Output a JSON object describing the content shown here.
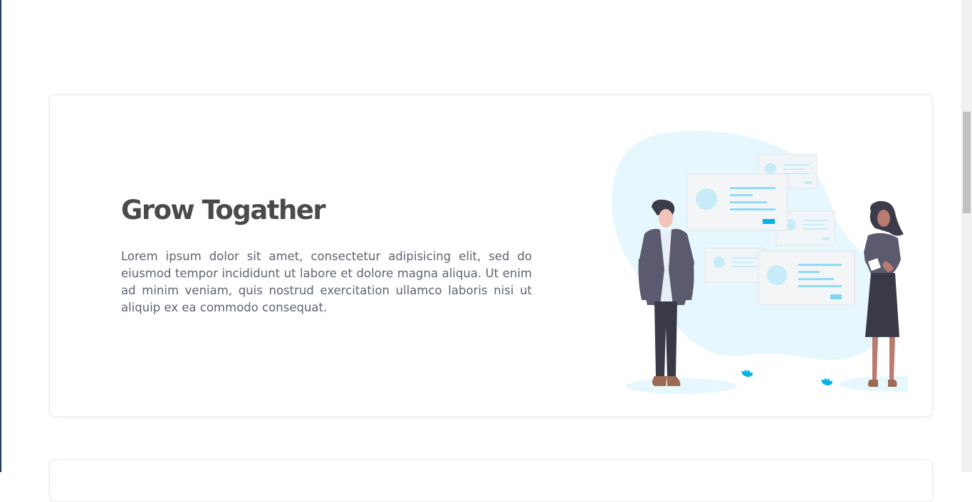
{
  "feature": {
    "title": "Grow Togather",
    "description": "Lorem ipsum dolor sit amet, consectetur adipisicing elit, sed do eiusmod tempor incididunt ut labore et dolore magna aliqua. Ut enim ad minim veniam, quis nostrud exercitation ullamco laboris nisi ut aliquip ex ea commodo consequat.",
    "illustration_icon": "two-people-collaboration-illustration"
  },
  "colors": {
    "accent": "#00b4e6",
    "blob": "#e6f7fd",
    "title": "#4a4a4a",
    "text": "#5d6470"
  }
}
